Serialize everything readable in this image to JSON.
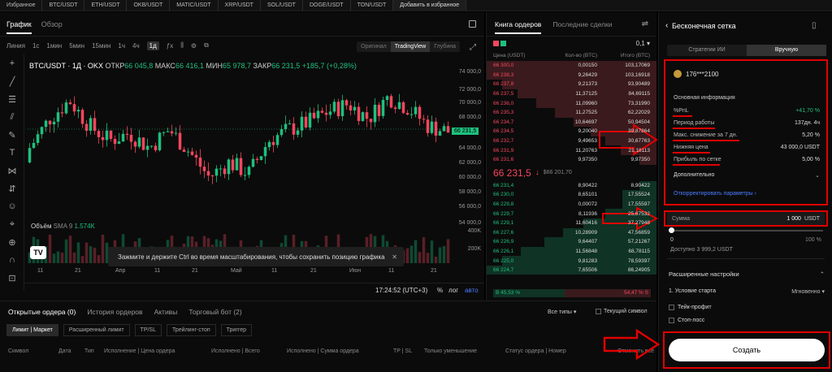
{
  "favorites": {
    "items": [
      "Избранное",
      "BTC/USDT",
      "ETH/USDT",
      "OKB/USDT",
      "MATIC/USDT",
      "XRP/USDT",
      "SOL/USDT",
      "DOGE/USDT",
      "TON/USDT"
    ],
    "add_label": "Добавить в избранное"
  },
  "chart_panel": {
    "tabs": [
      "График",
      "Обзор"
    ],
    "chart_types": [
      "Линия"
    ],
    "timeframes": [
      "1с",
      "1мин",
      "5мин",
      "15мин",
      "1ч",
      "4ч",
      "1д"
    ],
    "active_timeframe": "1д",
    "views": [
      "Оригинал",
      "TradingView",
      "Глубина"
    ],
    "active_view": "TradingView",
    "legend": {
      "pair": "BTC/USDT · 1Д · OKX",
      "o_label": "ОТКР",
      "o": "66 045,8",
      "h_label": "МАКС",
      "h": "66 416,1",
      "l_label": "МИН",
      "l": "65 978,7",
      "c_label": "ЗАКР",
      "c": "66 231,5",
      "chg": "+185,7 (+0,28%)"
    },
    "volume_label": "Объём",
    "sma_label": "SMA 9",
    "sma_value": "1.574K",
    "price_labels": [
      "74 000,0",
      "72 000,0",
      "70 000,0",
      "68 000,0",
      "66 231,5",
      "64 000,0",
      "62 000,0",
      "60 000,0",
      "58 000,0",
      "56 000,0",
      "54 000,0",
      "400K",
      "200K"
    ],
    "date_labels": [
      "11",
      "21",
      "Апр",
      "11",
      "21",
      "Май",
      "11",
      "21",
      "Июн",
      "11",
      "21"
    ],
    "tooltip": "Зажмите и держите Ctrl во время масштабирования, чтобы сохранить позицию графика",
    "clock": "17:24:52 (UTC+3)",
    "footer_opts": [
      "%",
      "лог",
      "авто"
    ]
  },
  "orderbook": {
    "tabs": [
      "Книга ордеров",
      "Последние сделки"
    ],
    "tick": "0,1",
    "col_price": "Цена (USDT)",
    "col_qty": "Кол-во (BTC)",
    "col_total": "Итого (BTC)",
    "asks": [
      {
        "p": "66 300,0",
        "q": "0,00150",
        "t": "103,17069",
        "d": 1.0
      },
      {
        "p": "66 238,3",
        "q": "9,26429",
        "t": "103,16918",
        "d": 1.0
      },
      {
        "p": "66 237,8",
        "q": "9,21373",
        "t": "93,90489",
        "d": 0.91
      },
      {
        "p": "66 237,5",
        "q": "11,37125",
        "t": "84,69115",
        "d": 0.82
      },
      {
        "p": "66 236,0",
        "q": "11,09960",
        "t": "73,31990",
        "d": 0.71
      },
      {
        "p": "66 235,3",
        "q": "11,27525",
        "t": "62,22029",
        "d": 0.6
      },
      {
        "p": "66 234,7",
        "q": "10,64697",
        "t": "50,94504",
        "d": 0.49
      },
      {
        "p": "66 234,5",
        "q": "9,20040",
        "t": "39,87864",
        "d": 0.39
      },
      {
        "p": "66 232,7",
        "q": "9,49653",
        "t": "30,67763",
        "d": 0.3
      },
      {
        "p": "66 231,9",
        "q": "11,20763",
        "t": "21,18113",
        "d": 0.21
      },
      {
        "p": "66 231,6",
        "q": "9,97350",
        "t": "9,97350",
        "d": 0.1
      }
    ],
    "mid": "66 231,5",
    "mid_arrow": "↓",
    "mid_sub": "$66 201,70",
    "bids": [
      {
        "p": "66 231,4",
        "q": "8,90422",
        "t": "8,90422",
        "d": 0.1
      },
      {
        "p": "66 230,0",
        "q": "8,65101",
        "t": "17,55524",
        "d": 0.2
      },
      {
        "p": "66 229,8",
        "q": "0,00072",
        "t": "17,55597",
        "d": 0.2
      },
      {
        "p": "66 229,7",
        "q": "8,11936",
        "t": "25,67532",
        "d": 0.3
      },
      {
        "p": "66 229,1",
        "q": "11,60416",
        "t": "37,27948",
        "d": 0.43
      },
      {
        "p": "66 227,6",
        "q": "10,28909",
        "t": "47,56859",
        "d": 0.55
      },
      {
        "p": "66 226,9",
        "q": "9,64407",
        "t": "57,21267",
        "d": 0.66
      },
      {
        "p": "66 226,1",
        "q": "11,56848",
        "t": "68,78115",
        "d": 0.8
      },
      {
        "p": "66 225,0",
        "q": "9,81283",
        "t": "78,59397",
        "d": 0.91
      },
      {
        "p": "66 224,7",
        "q": "7,65506",
        "t": "86,24905",
        "d": 1.0
      }
    ],
    "buy_ratio_label": "B",
    "buy_ratio": "45,53 %",
    "sell_ratio": "54,47 %",
    "sell_ratio_label": "S",
    "buy_ratio_value": 45.53
  },
  "grid_panel": {
    "title": "Бесконечная сетка",
    "modes": [
      "Стратегии ИИ",
      "Вручную"
    ],
    "active_mode": "Вручную",
    "user": "176***2100",
    "section": "Основная информация",
    "rows": [
      {
        "label": "%PnL",
        "value": "+41,70 %"
      },
      {
        "label": "Период работы",
        "value": "137дн. 4ч"
      },
      {
        "label": "Макс. снижение за 7 дн.",
        "value": "5,20 %"
      },
      {
        "label": "Нижняя цена",
        "value": "43 000,0 USDT"
      },
      {
        "label": "Прибыль по сетке",
        "value": "5,00 %"
      }
    ],
    "more": "Дополнительно",
    "adjust": "Откорректировать параметры",
    "amount_label": "Сумма",
    "amount_value": "1 000",
    "amount_unit": "USDT",
    "slider_min": "0",
    "slider_max": "100 %",
    "available": "Доступно 3 999,2 USDT",
    "advanced": "Расширенные настройки",
    "start_cond_label": "1. Условие старта",
    "start_cond_value": "Мгновенно",
    "take_profit": "Тейк-профит",
    "stop_loss": "Стоп-лосс",
    "create": "Создать"
  },
  "orders": {
    "tabs": [
      "Открытые ордера (0)",
      "История ордеров",
      "Активы",
      "Торговый бот (2)"
    ],
    "filter_types": "Все типы",
    "current_symbol": "Текущий символ",
    "chips": [
      "Лимит | Маркет",
      "Расширенный лимит",
      "TP/SL",
      "Трейлинг-стоп",
      "Триггер"
    ],
    "columns": [
      "Символ",
      "Дата",
      "Тип",
      "Исполнение | Цена ордера",
      "Исполнено | Всего",
      "Исполнено | Сумма ордера",
      "TP | SL",
      "Только уменьшение",
      "Статус ордера | Номер",
      "Отменить все"
    ]
  },
  "colors": {
    "up": "#1ec07e",
    "down": "#f6465d",
    "annotation": "#e00000"
  }
}
